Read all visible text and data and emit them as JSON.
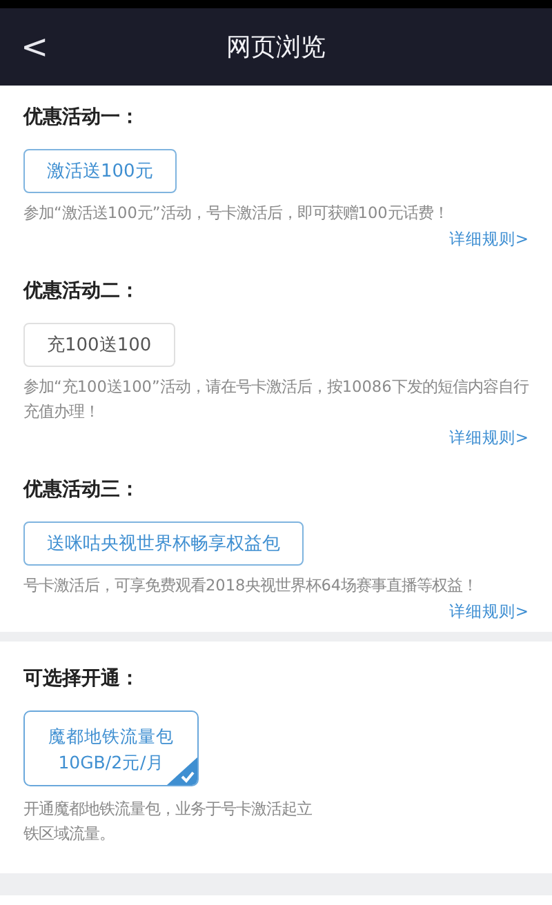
{
  "header": {
    "back": "<",
    "title": "网页浏览"
  },
  "promotions": [
    {
      "title": "优惠活动一：",
      "option": "激活送100元",
      "selected": true,
      "description": [
        "参加“激活送100元”活动，号卡激活后，即可获赠100元话费！"
      ],
      "link": "详细规则>"
    },
    {
      "title": "优惠活动二：",
      "option": "充100送100",
      "selected": false,
      "description": [
        "参加“充100送100”活动，请在号卡激活后，按10086下发的短信内容自行充值办理！"
      ],
      "link": "详细规则>"
    },
    {
      "title": "优惠活动三：",
      "option": "送咪咕央视世界杯畅享权益包",
      "selected": true,
      "description": [
        "号卡激活后，可享免费观看2018央视世界杯64场赛事直播等权益！"
      ],
      "link": "详细规则>"
    }
  ],
  "optional": {
    "title": "可选择开通：",
    "package": {
      "name": "魔都地铁流量包",
      "price": "10GB/2元/月",
      "checked": true
    },
    "description": [
      "开通魔都地铁流量包，业务于号卡激活起立",
      "铁区域流量。"
    ]
  }
}
